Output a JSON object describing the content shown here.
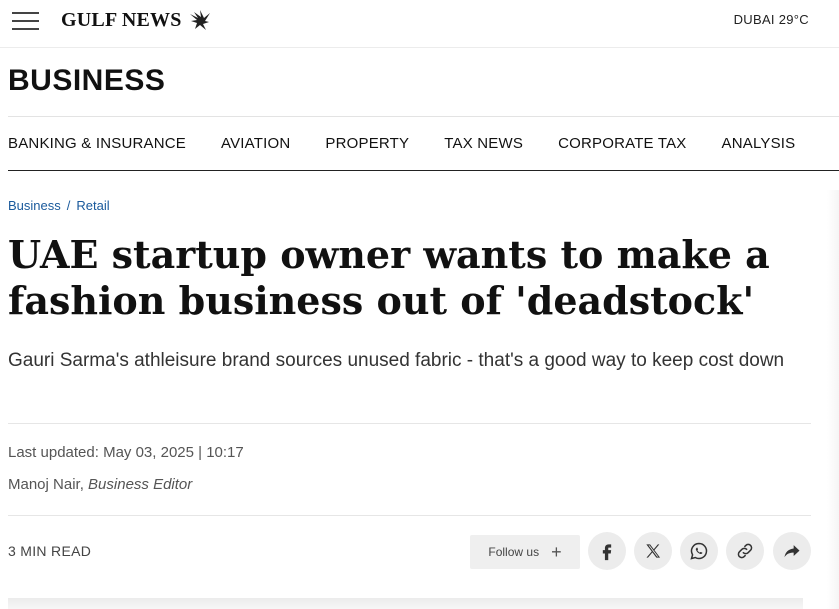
{
  "header": {
    "logo_text": "GULF NEWS",
    "weather": "DUBAI 29°C"
  },
  "section": {
    "title": "BUSINESS"
  },
  "subnav": {
    "items": [
      "BANKING & INSURANCE",
      "AVIATION",
      "PROPERTY",
      "TAX NEWS",
      "CORPORATE TAX",
      "ANALYSIS"
    ]
  },
  "breadcrumb": {
    "items": [
      "Business",
      "Retail"
    ],
    "separator": "/"
  },
  "article": {
    "headline": "UAE startup owner wants to make a fashion business out of 'deadstock'",
    "subheadline": "Gauri Sarma's athleisure brand sources unused fabric - that's a good way to keep cost down",
    "updated": "Last updated: May 03, 2025 | 10:17",
    "author_name": "Manoj Nair,",
    "author_role": "Business Editor",
    "read_time": "3 MIN READ"
  },
  "actions": {
    "follow_label": "Follow us",
    "follow_icon": "plus-icon",
    "share_icons": [
      "facebook-icon",
      "x-icon",
      "whatsapp-icon",
      "copy-link-icon",
      "share-arrow-icon"
    ]
  }
}
